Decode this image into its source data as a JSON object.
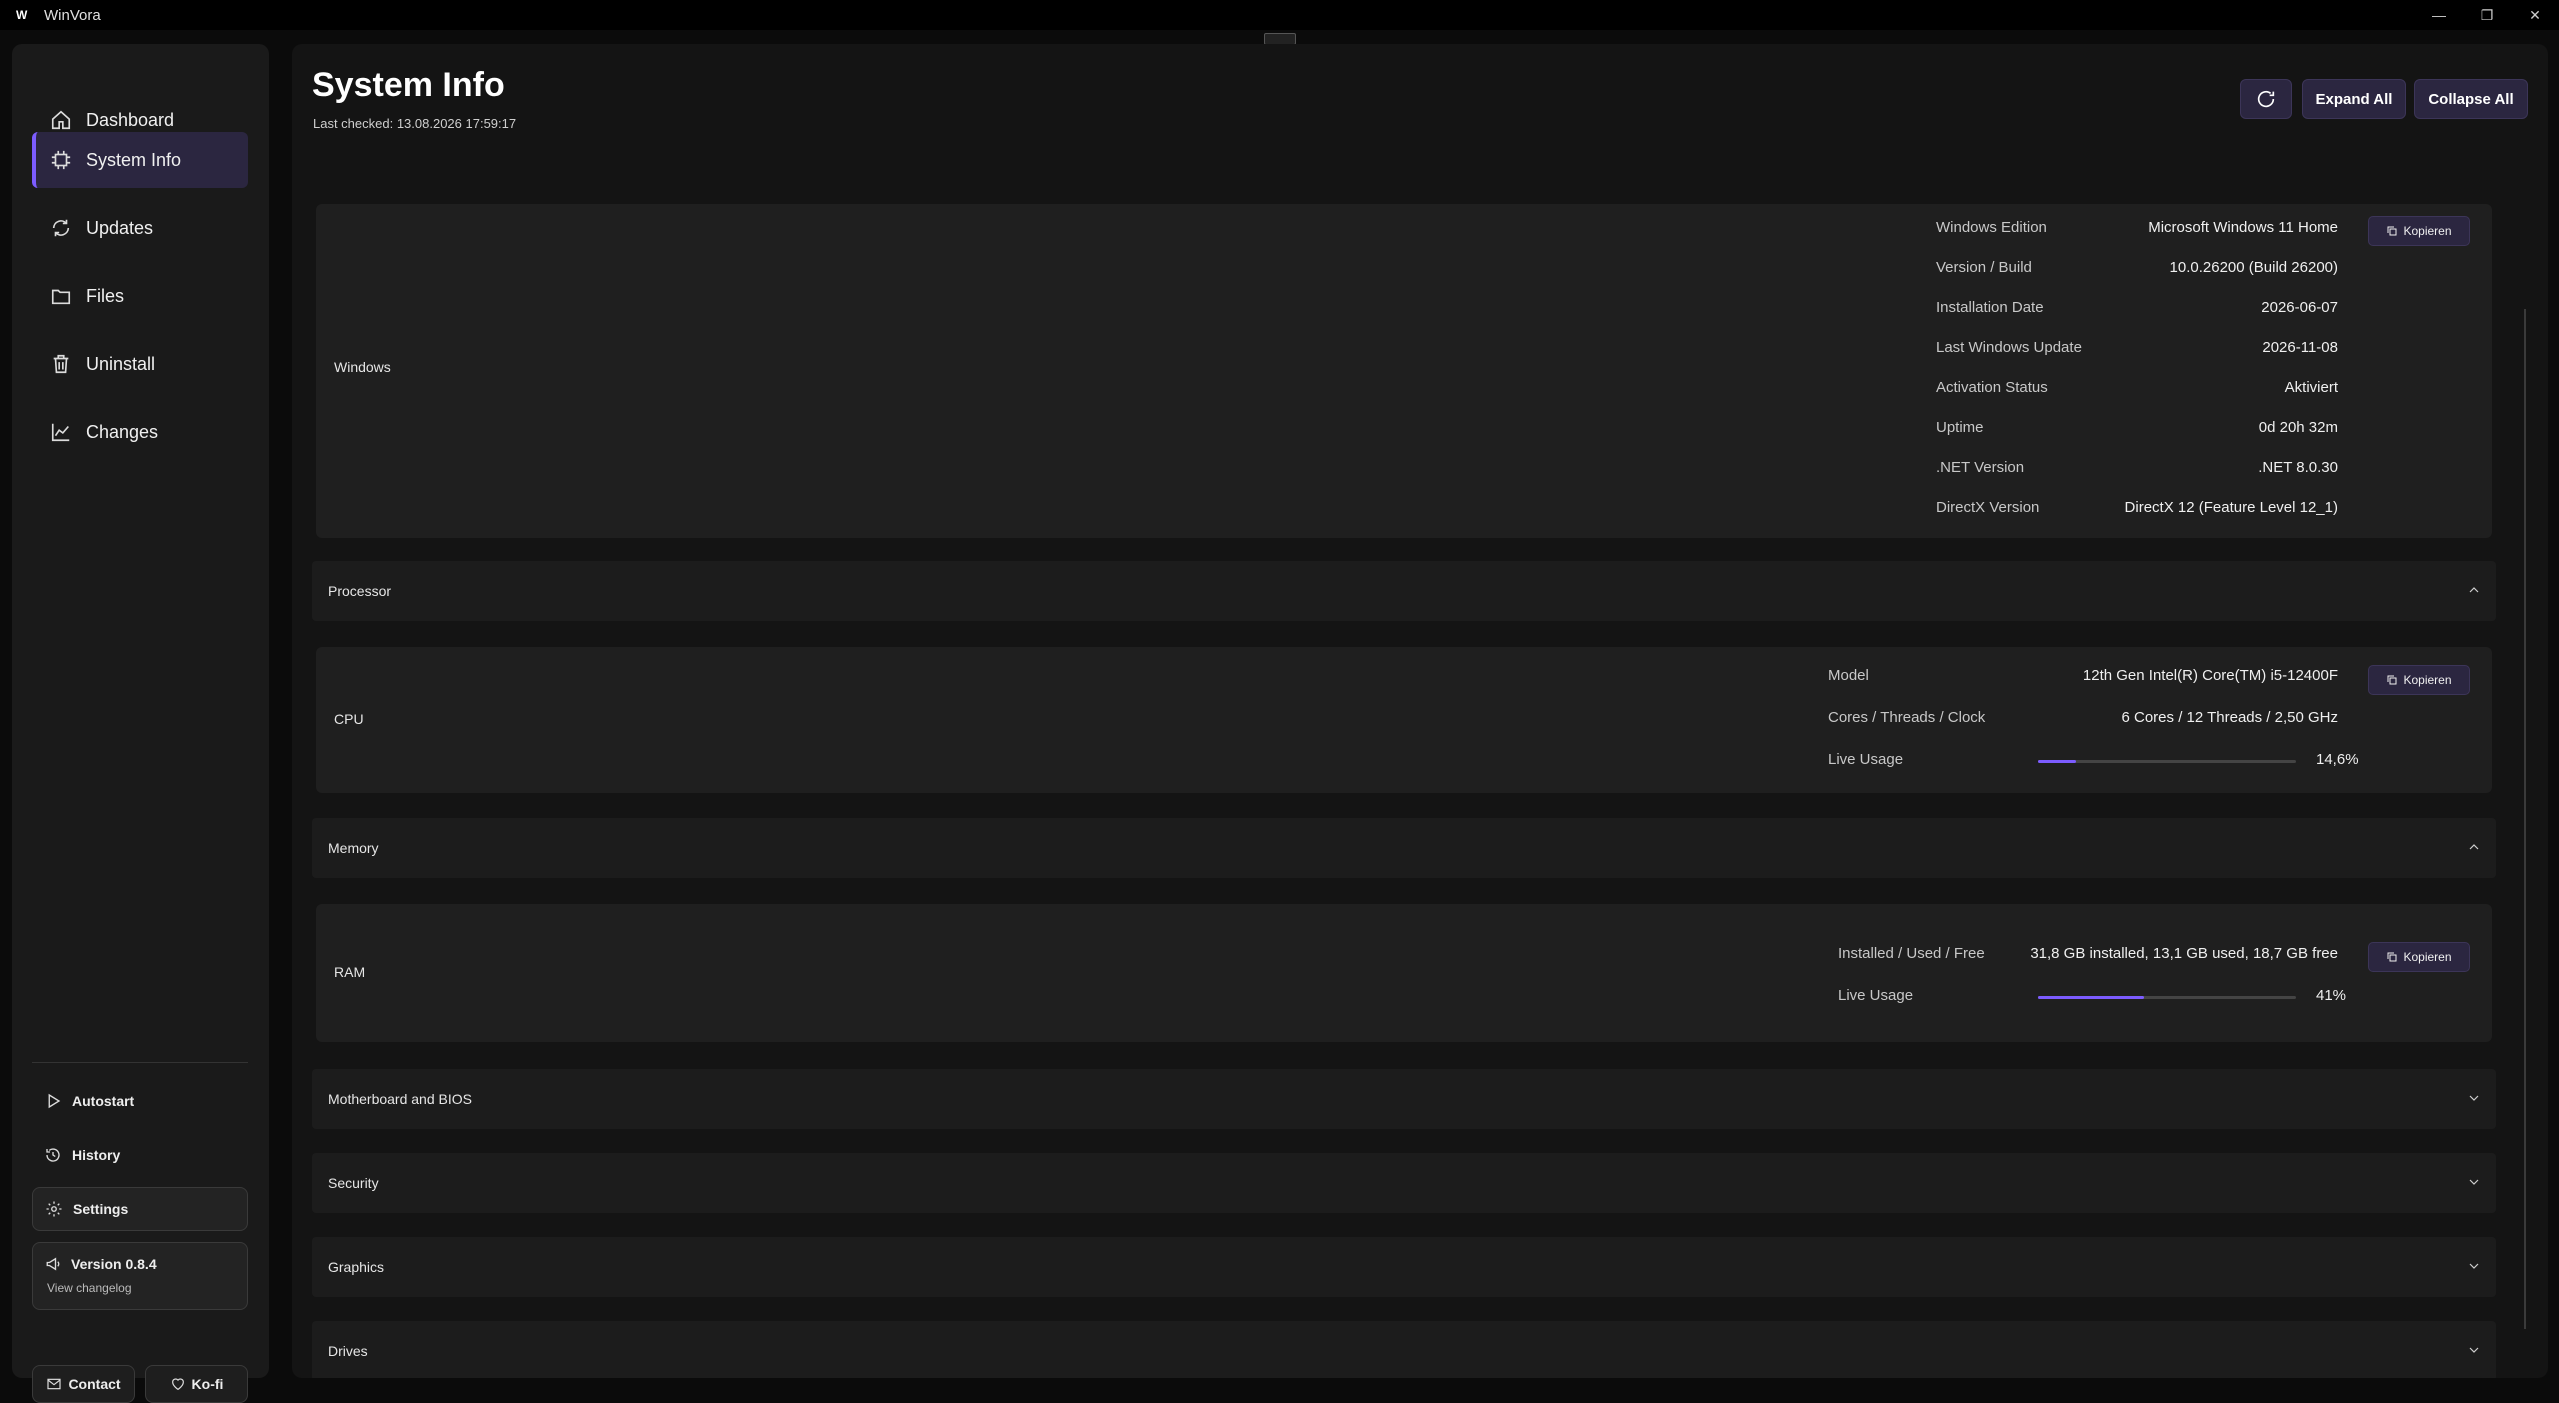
{
  "window": {
    "logo": "W",
    "title": "WinVora",
    "minimize": "—",
    "restore": "❐",
    "close": "✕"
  },
  "sidebar": {
    "nav": [
      {
        "label": "Dashboard",
        "icon": "home-icon"
      },
      {
        "label": "System Info",
        "icon": "chip-icon",
        "active": true
      },
      {
        "label": "Updates",
        "icon": "refresh-icon"
      },
      {
        "label": "Files",
        "icon": "folder-icon"
      },
      {
        "label": "Uninstall",
        "icon": "trash-icon"
      },
      {
        "label": "Changes",
        "icon": "chart-icon"
      }
    ],
    "autostart": "Autostart",
    "history": "History",
    "settings": "Settings",
    "version": "Version 0.8.4",
    "changelog": "View changelog",
    "contact": "Contact",
    "kofi": "Ko-fi"
  },
  "header": {
    "title": "System Info",
    "last_checked": "Last checked: 13.08.2026 17:59:17",
    "expand_all": "Expand All",
    "collapse_all": "Collapse All"
  },
  "copy_label": "Kopieren",
  "windows": {
    "title": "Windows",
    "rows": [
      {
        "label": "Windows Edition",
        "value": "Microsoft Windows 11 Home"
      },
      {
        "label": "Version / Build",
        "value": "10.0.26200 (Build 26200)"
      },
      {
        "label": "Installation Date",
        "value": "2026-06-07"
      },
      {
        "label": "Last Windows Update",
        "value": "2026-11-08"
      },
      {
        "label": "Activation Status",
        "value": "Aktiviert"
      },
      {
        "label": "Uptime",
        "value": "0d 20h 32m"
      },
      {
        "label": ".NET Version",
        "value": ".NET 8.0.30"
      },
      {
        "label": "DirectX Version",
        "value": "DirectX 12 (Feature Level 12_1)"
      }
    ]
  },
  "processor": {
    "section": "Processor",
    "card": "CPU",
    "rows": [
      {
        "label": "Model",
        "value": "12th Gen Intel(R) Core(TM) i5-12400F"
      },
      {
        "label": "Cores / Threads / Clock",
        "value": "6 Cores / 12 Threads / 2,50 GHz"
      }
    ],
    "usage_label": "Live Usage",
    "usage_value": "14,6%",
    "usage_fraction": 0.146
  },
  "memory": {
    "section": "Memory",
    "card": "RAM",
    "rows": [
      {
        "label": "Installed / Used / Free",
        "value": "31,8 GB installed, 13,1 GB used, 18,7 GB free"
      }
    ],
    "usage_label": "Live Usage",
    "usage_value": "41%",
    "usage_fraction": 0.41
  },
  "collapsed_sections": [
    "Motherboard and BIOS",
    "Security",
    "Graphics",
    "Drives"
  ]
}
